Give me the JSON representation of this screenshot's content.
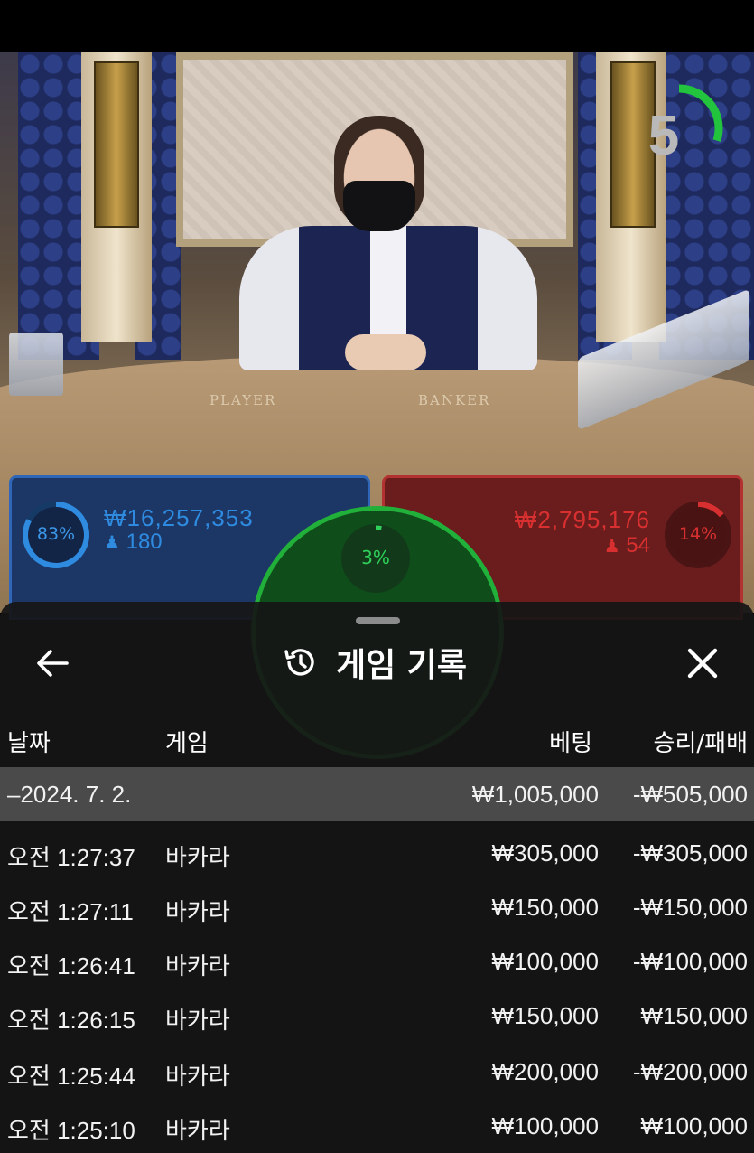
{
  "timer": {
    "value": "5",
    "fraction_remaining": 0.3
  },
  "table_labels": {
    "player": "PLAYER",
    "banker": "BANKER"
  },
  "player": {
    "percent_label": "83%",
    "percent": 83,
    "amount": "₩16,257,353",
    "count": "180",
    "color": "#2f8be0"
  },
  "tie": {
    "percent_label": "3%",
    "percent": 3,
    "color": "#21b03a"
  },
  "banker": {
    "percent_label": "14%",
    "percent": 14,
    "amount": "₩2,795,176",
    "count": "54",
    "color": "#d83030"
  },
  "sheet": {
    "title": "게임 기록",
    "back_icon": "arrow-left-icon",
    "history_icon": "history-icon",
    "close_icon": "close-icon",
    "columns": {
      "date": "날짜",
      "game": "게임",
      "bet": "베팅",
      "result": "승리/패배"
    },
    "date_group": {
      "label": "–2024. 7. 2.",
      "bet": "₩1,005,000",
      "result": "-₩505,000"
    },
    "rows": [
      {
        "time": "오전 1:27:37",
        "game": "바카라",
        "bet": "₩305,000",
        "result": "-₩305,000"
      },
      {
        "time": "오전 1:27:11",
        "game": "바카라",
        "bet": "₩150,000",
        "result": "-₩150,000"
      },
      {
        "time": "오전 1:26:41",
        "game": "바카라",
        "bet": "₩100,000",
        "result": "-₩100,000"
      },
      {
        "time": "오전 1:26:15",
        "game": "바카라",
        "bet": "₩150,000",
        "result": "₩150,000"
      },
      {
        "time": "오전 1:25:44",
        "game": "바카라",
        "bet": "₩200,000",
        "result": "-₩200,000"
      },
      {
        "time": "오전 1:25:10",
        "game": "바카라",
        "bet": "₩100,000",
        "result": "₩100,000"
      }
    ]
  }
}
